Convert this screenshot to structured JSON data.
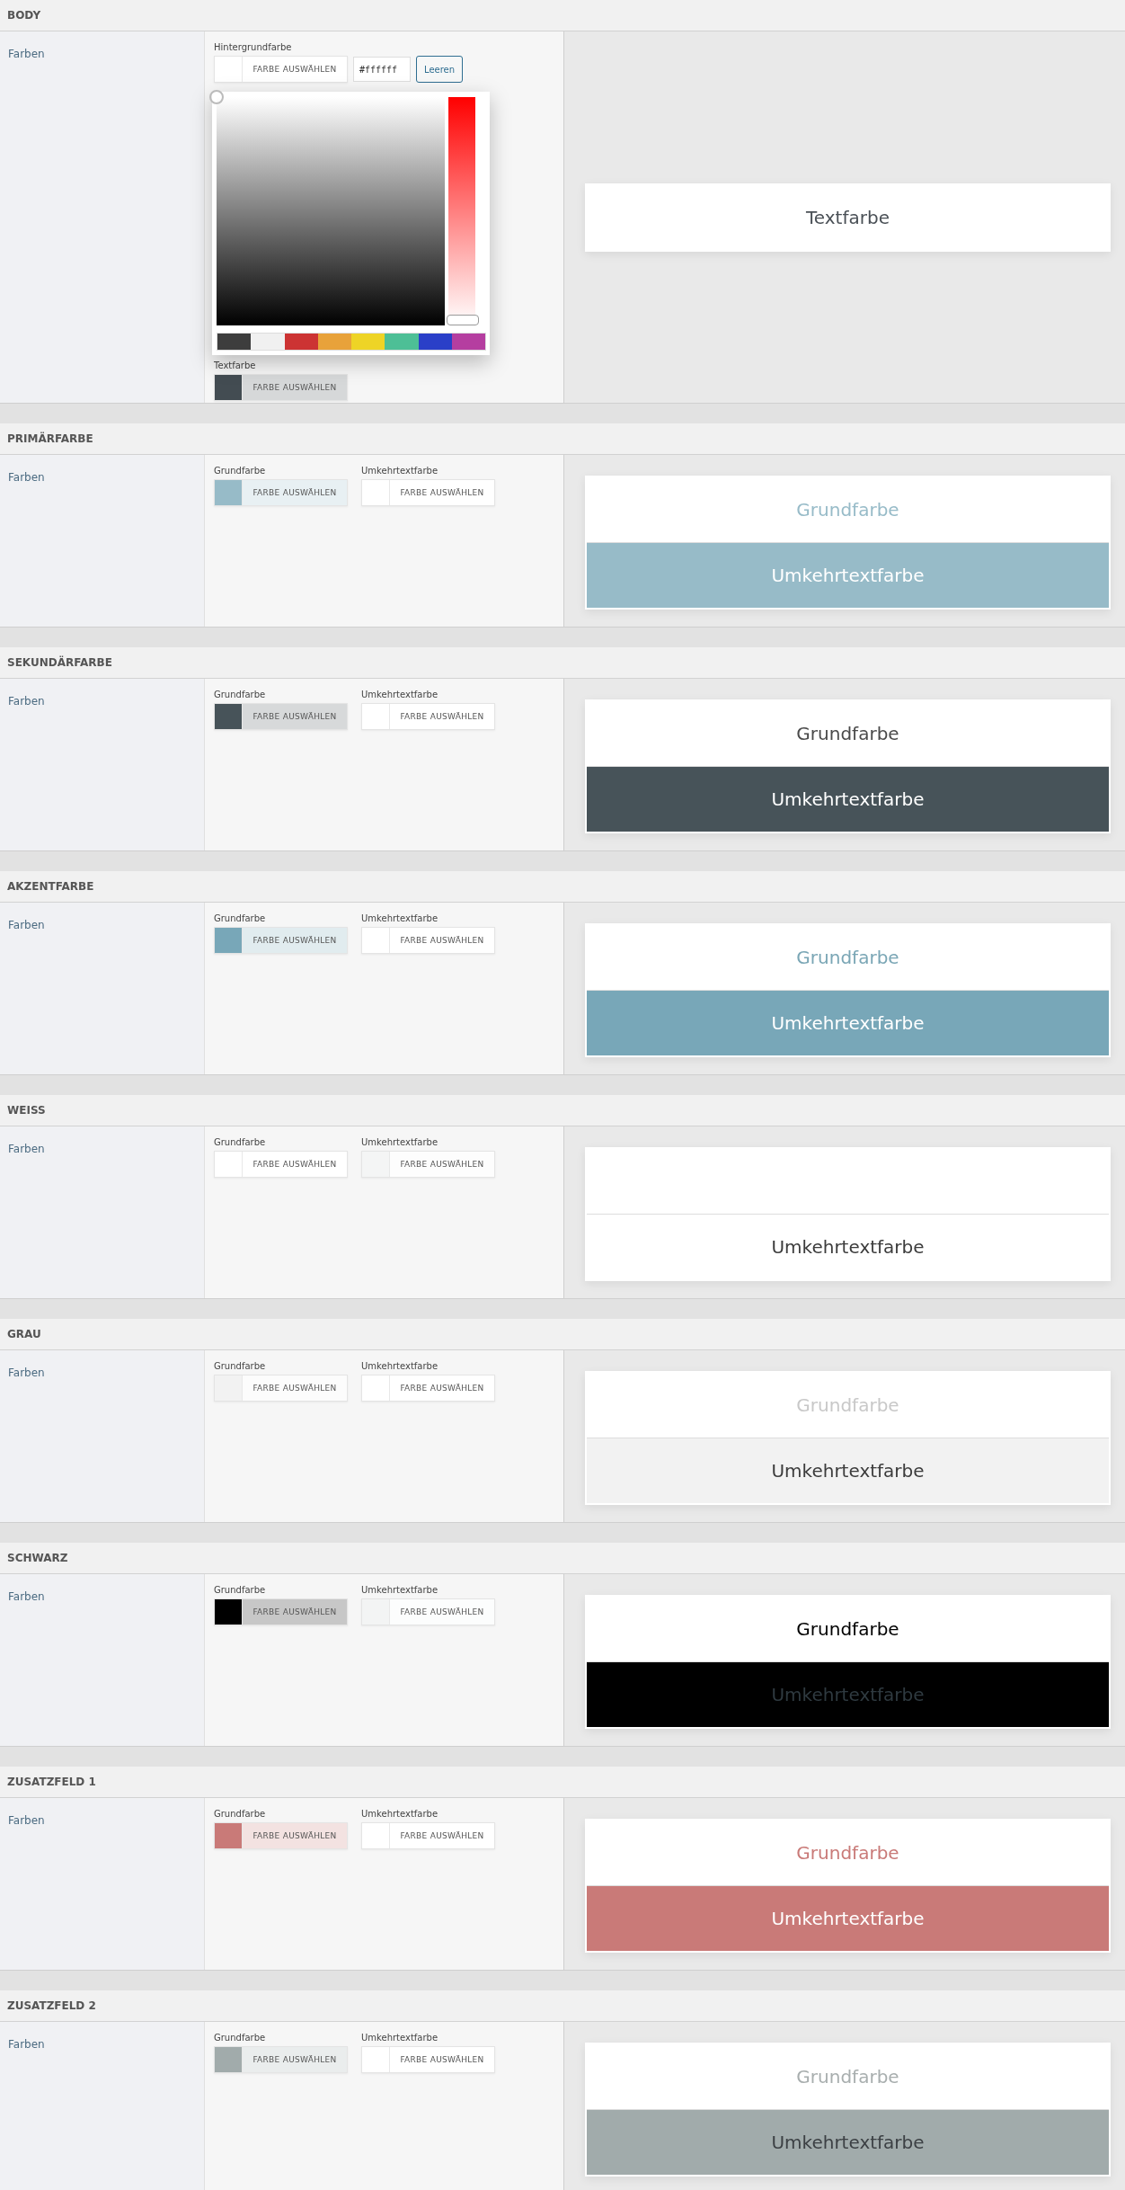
{
  "sections": [
    {
      "title": "BODY",
      "label": "Farben",
      "fields": [
        {
          "label": "Hintergrundfarbe",
          "color": "#ffffff",
          "button": "FARBE AUSWÄHLEN",
          "value": "#ffffff",
          "clear": "Leeren",
          "picker": {
            "hue_slider": {
              "level": 0
            },
            "palette": [
              {
                "color": "#3d3d3d"
              },
              {
                "color": "#f0f0f0"
              },
              {
                "color": "#cc3333"
              },
              {
                "color": "#e8a23a"
              },
              {
                "color": "#eed426"
              },
              {
                "color": "#4dbf96"
              },
              {
                "color": "#2a3fc8"
              },
              {
                "color": "#b53ea0"
              }
            ]
          }
        },
        {
          "label": "Textfarbe",
          "color": "#434c52",
          "button": "FARBE AUSWÄHLEN"
        }
      ],
      "preview": [
        {
          "kind": "base",
          "text": "Textfarbe",
          "color": "#4a5056"
        }
      ]
    },
    {
      "title": "PRIMÄRFARBE",
      "label": "Farben",
      "fields": [
        {
          "label": "Grundfarbe",
          "color": "#97bbc8",
          "button": "FARBE AUSWÄHLEN"
        },
        {
          "label": "Umkehrtextfarbe",
          "color": "#ffffff",
          "button": "FARBE AUSWÄHLEN"
        }
      ],
      "preview": [
        {
          "kind": "base",
          "text": "Grundfarbe",
          "color": "#97bbc8"
        },
        {
          "kind": "inverse",
          "text": "Umkehrtextfarbe",
          "color": "#ffffff"
        }
      ]
    },
    {
      "title": "SEKUNDÄRFARBE",
      "label": "Farben",
      "fields": [
        {
          "label": "Grundfarbe",
          "color": "#475359",
          "button": "FARBE AUSWÄHLEN"
        },
        {
          "label": "Umkehrtextfarbe",
          "color": "#ffffff",
          "button": "FARBE AUSWÄHLEN"
        }
      ],
      "preview": [
        {
          "kind": "base",
          "text": "Grundfarbe",
          "color": "#4a4a4a"
        },
        {
          "kind": "inverse",
          "text": "Umkehrtextfarbe",
          "color": "#ffffff"
        }
      ]
    },
    {
      "title": "AKZENTFARBE",
      "label": "Farben",
      "fields": [
        {
          "label": "Grundfarbe",
          "color": "#78a7b8",
          "button": "FARBE AUSWÄHLEN"
        },
        {
          "label": "Umkehrtextfarbe",
          "color": "#ffffff",
          "button": "FARBE AUSWÄHLEN"
        }
      ],
      "preview": [
        {
          "kind": "base",
          "text": "Grundfarbe",
          "color": "#7aa6b5"
        },
        {
          "kind": "inverse",
          "text": "Umkehrtextfarbe",
          "color": "#ffffff"
        }
      ]
    },
    {
      "title": "WEISS",
      "label": "Farben",
      "fields": [
        {
          "label": "Grundfarbe",
          "color": "#ffffff",
          "button": "FARBE AUSWÄHLEN"
        },
        {
          "label": "Umkehrtextfarbe",
          "color": "#f4f5f5",
          "button": "FARBE AUSWÄHLEN"
        }
      ],
      "preview": [
        {
          "kind": "base"
        },
        {
          "kind": "inverse",
          "text": "Umkehrtextfarbe",
          "color": "#3c3c3c"
        }
      ]
    },
    {
      "title": "GRAU",
      "label": "Farben",
      "fields": [
        {
          "label": "Grundfarbe",
          "color": "#f2f2f2",
          "button": "FARBE AUSWÄHLEN"
        },
        {
          "label": "Umkehrtextfarbe",
          "color": "#ffffff",
          "button": "FARBE AUSWÄHLEN"
        }
      ],
      "preview": [
        {
          "kind": "base",
          "text": "Grundfarbe",
          "color": "#c8c8c8"
        },
        {
          "kind": "inverse",
          "text": "Umkehrtextfarbe",
          "color": "#3c3c3c"
        }
      ]
    },
    {
      "title": "SCHWARZ",
      "label": "Farben",
      "fields": [
        {
          "label": "Grundfarbe",
          "color": "#000000",
          "button": "FARBE AUSWÄHLEN"
        },
        {
          "label": "Umkehrtextfarbe",
          "color": "#f3f4f4",
          "button": "FARBE AUSWÄHLEN"
        }
      ],
      "preview": [
        {
          "kind": "base",
          "text": "Grundfarbe",
          "color": "#000000"
        },
        {
          "kind": "inverse",
          "text": "Umkehrtextfarbe",
          "color": "#2f3a40"
        }
      ]
    },
    {
      "title": "ZUSATZFELD 1",
      "label": "Farben",
      "fields": [
        {
          "label": "Grundfarbe",
          "color": "#c97a78",
          "button": "FARBE AUSWÄHLEN"
        },
        {
          "label": "Umkehrtextfarbe",
          "color": "#ffffff",
          "button": "FARBE AUSWÄHLEN"
        }
      ],
      "preview": [
        {
          "kind": "base",
          "text": "Grundfarbe",
          "color": "#c97a78"
        },
        {
          "kind": "inverse",
          "text": "Umkehrtextfarbe",
          "color": "#ffffff"
        }
      ]
    },
    {
      "title": "ZUSATZFELD 2",
      "label": "Farben",
      "fields": [
        {
          "label": "Grundfarbe",
          "color": "#a1abab",
          "button": "FARBE AUSWÄHLEN"
        },
        {
          "label": "Umkehrtextfarbe",
          "color": "#ffffff",
          "button": "FARBE AUSWÄHLEN"
        }
      ],
      "preview": [
        {
          "kind": "base",
          "text": "Grundfarbe",
          "color": "#a8aeae"
        },
        {
          "kind": "inverse",
          "text": "Umkehrtextfarbe",
          "color": "#3c4044"
        }
      ]
    }
  ]
}
